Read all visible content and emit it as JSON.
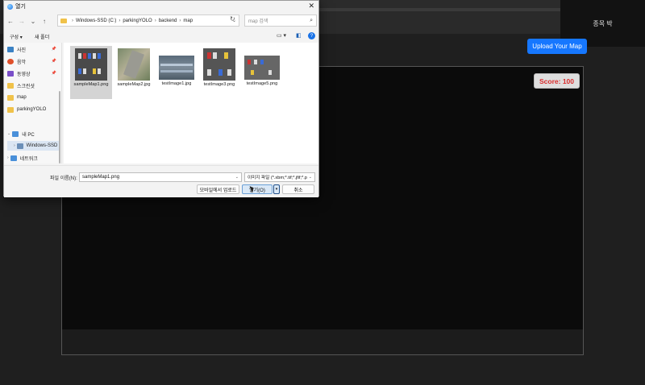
{
  "background": {
    "upload_button": "Upload Your Map",
    "end_game_button": "종목 박",
    "score_label": "Score: 100"
  },
  "dialog": {
    "title": "열기",
    "breadcrumb": [
      "Windows-SSD (C:)",
      "parkingYOLO",
      "backend",
      "map"
    ],
    "search_placeholder": "map 검색",
    "toolbar": {
      "organize": "구성",
      "new_folder": "새 폴더"
    },
    "sidebar": [
      {
        "label": "사진",
        "icon": "photos-icon",
        "color": "#3b82c4",
        "pinned": true
      },
      {
        "label": "음악",
        "icon": "music-icon",
        "color": "#e0502a",
        "pinned": true
      },
      {
        "label": "동영상",
        "icon": "video-icon",
        "color": "#7a4fc9",
        "pinned": true
      },
      {
        "label": "스크린샷",
        "icon": "folder-icon",
        "color": "#f0c24a",
        "pinned": false
      },
      {
        "label": "map",
        "icon": "folder-icon",
        "color": "#f0c24a",
        "pinned": false
      },
      {
        "label": "parkingYOLO",
        "icon": "folder-icon",
        "color": "#f0c24a",
        "pinned": false
      },
      {
        "label": "내 PC",
        "icon": "pc-icon",
        "color": "#4a90d9",
        "pinned": false
      },
      {
        "label": "Windows-SSD",
        "icon": "drive-icon",
        "color": "#6b8fb8",
        "pinned": false
      },
      {
        "label": "네트워크",
        "icon": "network-icon",
        "color": "#4a90d9",
        "pinned": false
      }
    ],
    "files": [
      {
        "name": "sampleMap1.png",
        "selected": true
      },
      {
        "name": "sampleMap2.jpg",
        "selected": false
      },
      {
        "name": "testImage1.jpg",
        "selected": false
      },
      {
        "name": "testImage3.png",
        "selected": false
      },
      {
        "name": "testImage5.png",
        "selected": false
      }
    ],
    "filename_label": "파일 이름(N):",
    "filename_value": "sampleMap1.png",
    "filetype_value": "이미지 파일 (*.xbm;*.tif;*.jfif;*.p",
    "mobile_upload_button": "모바일에서 업로드",
    "open_button": "열기(O)",
    "cancel_button": "취소"
  }
}
